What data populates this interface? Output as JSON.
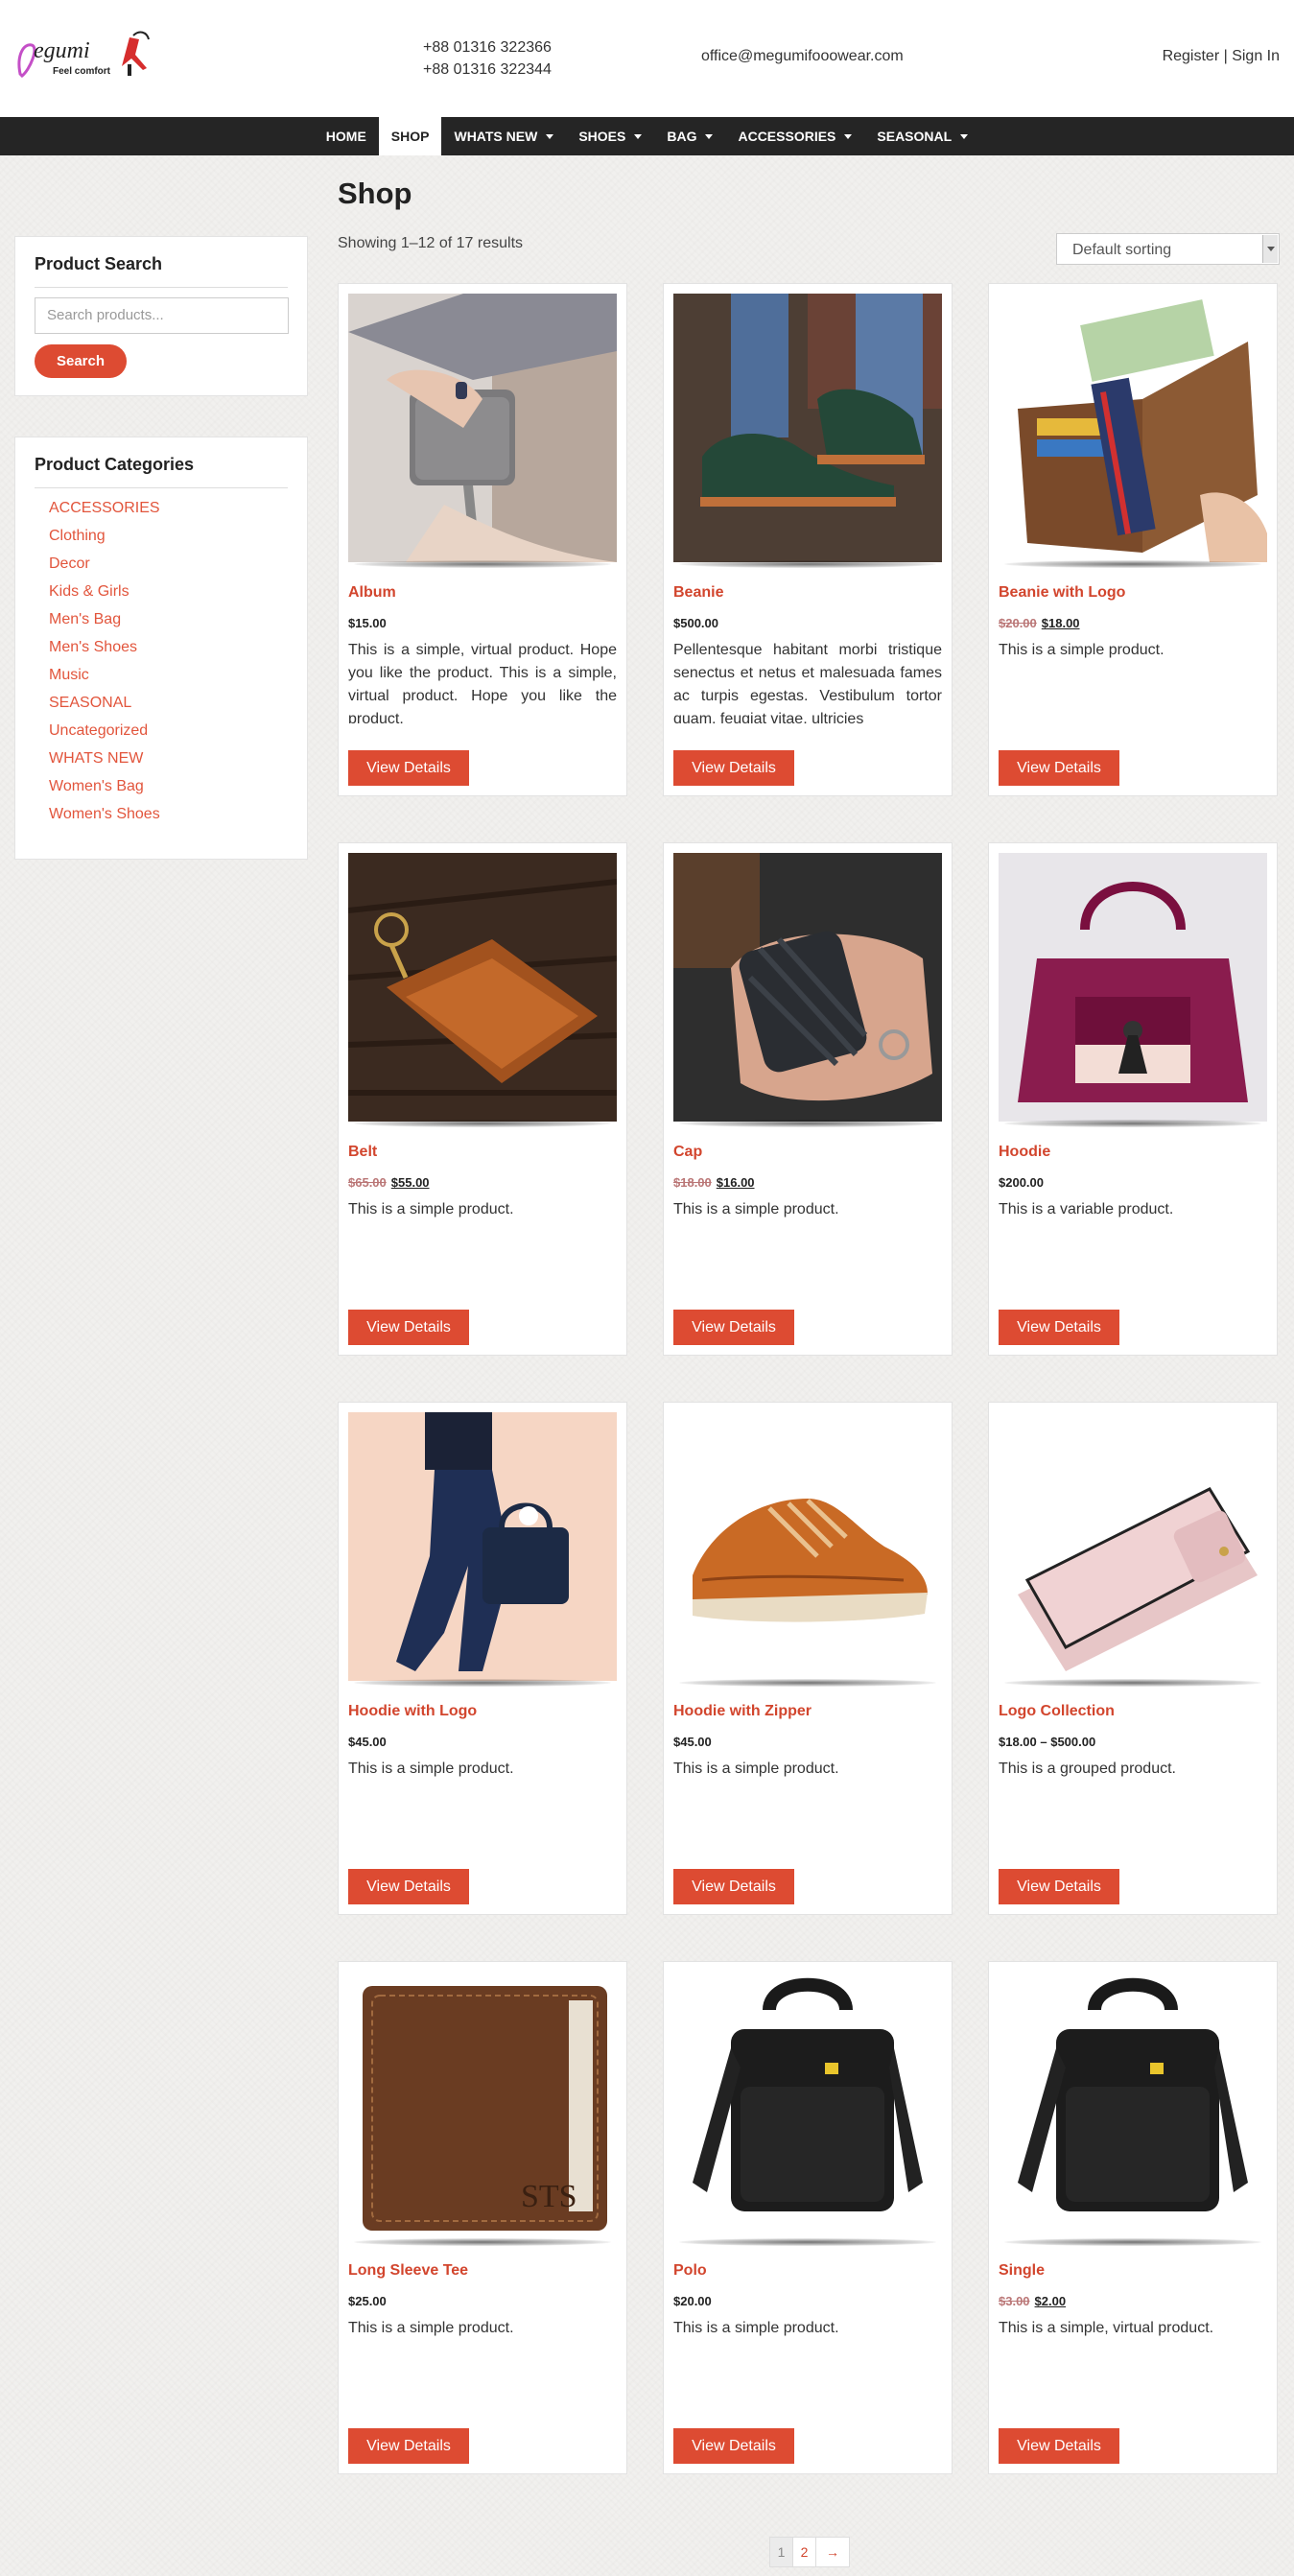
{
  "header": {
    "logo_text": "Megumi",
    "logo_tagline": "Feel comfort",
    "phones": [
      "+88 01316 322366",
      "+88 01316 322344"
    ],
    "email": "office@megumifooowear.com",
    "register": "Register",
    "separator": " | ",
    "sign_in": "Sign In"
  },
  "nav": {
    "items": [
      {
        "label": "HOME",
        "dropdown": false
      },
      {
        "label": "SHOP",
        "dropdown": false,
        "active": true
      },
      {
        "label": "WHATS NEW",
        "dropdown": true
      },
      {
        "label": "SHOES",
        "dropdown": true
      },
      {
        "label": "BAG",
        "dropdown": true
      },
      {
        "label": "ACCESSORIES",
        "dropdown": true
      },
      {
        "label": "SEASONAL",
        "dropdown": true
      }
    ]
  },
  "sidebar": {
    "search": {
      "title": "Product Search",
      "placeholder": "Search products...",
      "button": "Search"
    },
    "categories": {
      "title": "Product Categories",
      "items": [
        "ACCESSORIES",
        "Clothing",
        "Decor",
        "Kids & Girls",
        "Men's Bag",
        "Men's Shoes",
        "Music",
        "SEASONAL",
        "Uncategorized",
        "WHATS NEW",
        "Women's Bag",
        "Women's Shoes"
      ]
    }
  },
  "main": {
    "title": "Shop",
    "result_count": "Showing 1–12 of 17 results",
    "sorting": "Default sorting",
    "view_details": "View Details",
    "products": [
      {
        "name": "Album",
        "price": "$15.00",
        "old_price": "",
        "desc": "This is a simple, virtual product. Hope you like the product. This is a simple, virtual product. Hope you like the product.",
        "image": "wallet-hand-icon"
      },
      {
        "name": "Beanie",
        "price": "$500.00",
        "old_price": "",
        "desc": "Pellentesque habitant morbi tristique senectus et netus et malesuada fames ac turpis egestas. Vestibulum tortor quam, feugiat vitae, ultricies",
        "image": "green-shoe-icon"
      },
      {
        "name": "Beanie with Logo",
        "price": "$18.00",
        "old_price": "$20.00",
        "desc": "This is a simple product.",
        "image": "passport-wallet-icon"
      },
      {
        "name": "Belt",
        "price": "$55.00",
        "old_price": "$65.00",
        "desc": "This is a simple product.",
        "image": "key-case-icon"
      },
      {
        "name": "Cap",
        "price": "$16.00",
        "old_price": "$18.00",
        "desc": "This is a simple product.",
        "image": "woven-case-icon"
      },
      {
        "name": "Hoodie",
        "price": "$200.00",
        "old_price": "",
        "desc": "This is a variable product.",
        "image": "handbag-icon"
      },
      {
        "name": "Hoodie with Logo",
        "price": "$45.00",
        "old_price": "",
        "desc": "This is a simple product.",
        "image": "man-briefcase-icon"
      },
      {
        "name": "Hoodie with Zipper",
        "price": "$45.00",
        "old_price": "",
        "desc": "This is a simple product.",
        "image": "sneaker-icon"
      },
      {
        "name": "Logo Collection",
        "price": "$18.00 – $500.00",
        "old_price": "",
        "desc": "This is a grouped product.",
        "image": "pink-wallet-icon"
      },
      {
        "name": "Long Sleeve Tee",
        "price": "$25.00",
        "old_price": "",
        "desc": "This is a simple product.",
        "image": "bifold-wallet-icon"
      },
      {
        "name": "Polo",
        "price": "$20.00",
        "old_price": "",
        "desc": "This is a simple product.",
        "image": "laptop-bag-icon"
      },
      {
        "name": "Single",
        "price": "$2.00",
        "old_price": "$3.00",
        "desc": "This is a simple, virtual product.",
        "image": "laptop-bag-icon"
      }
    ]
  },
  "pagination": {
    "pages": [
      "1",
      "2"
    ],
    "next": "→",
    "current": "1"
  },
  "colors": {
    "accent": "#dd4b32",
    "nav_bg": "#252525",
    "link": "#e2553c"
  }
}
